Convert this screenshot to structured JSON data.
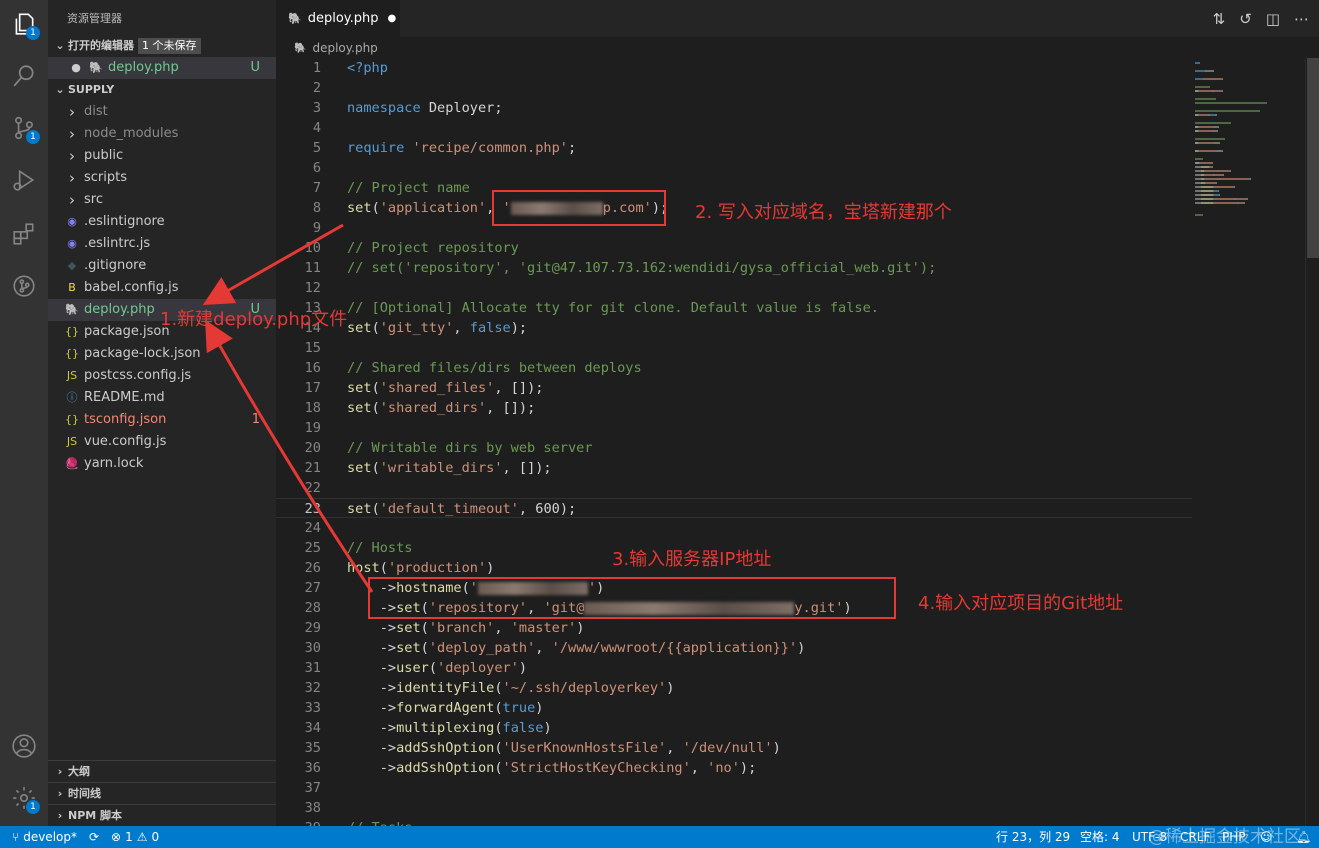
{
  "activity": {
    "explorer_badge": "1",
    "scm_badge": "1",
    "settings_badge": "1"
  },
  "sidebar": {
    "title": "资源管理器",
    "open_editors": {
      "label": "打开的编辑器",
      "unsaved": "1 个未保存",
      "file": "deploy.php",
      "status": "U"
    },
    "project": "SUPPLY",
    "items": [
      {
        "label": "dist",
        "type": "folder",
        "color": "#8c8c8c"
      },
      {
        "label": "node_modules",
        "type": "folder",
        "color": "#8c8c8c"
      },
      {
        "label": "public",
        "type": "folder",
        "color": "#cccccc"
      },
      {
        "label": "scripts",
        "type": "folder",
        "color": "#cccccc"
      },
      {
        "label": "src",
        "type": "folder",
        "color": "#cccccc"
      },
      {
        "label": ".eslintignore",
        "type": "eslint",
        "color": "#cccccc"
      },
      {
        "label": ".eslintrc.js",
        "type": "eslint",
        "color": "#cccccc"
      },
      {
        "label": ".gitignore",
        "type": "git",
        "color": "#cccccc"
      },
      {
        "label": "babel.config.js",
        "type": "babel",
        "color": "#cccccc"
      },
      {
        "label": "deploy.php",
        "type": "php",
        "color": "#73c991",
        "status": "U"
      },
      {
        "label": "package.json",
        "type": "json",
        "color": "#cccccc"
      },
      {
        "label": "package-lock.json",
        "type": "json",
        "color": "#cccccc"
      },
      {
        "label": "postcss.config.js",
        "type": "js",
        "color": "#cccccc"
      },
      {
        "label": "README.md",
        "type": "info",
        "color": "#cccccc"
      },
      {
        "label": "tsconfig.json",
        "type": "json",
        "color": "#f48771",
        "status": "1"
      },
      {
        "label": "vue.config.js",
        "type": "js",
        "color": "#cccccc"
      },
      {
        "label": "yarn.lock",
        "type": "yarn",
        "color": "#cccccc"
      }
    ],
    "outline": "大纲",
    "timeline": "时间线",
    "npm": "NPM 脚本"
  },
  "tab": {
    "label": "deploy.php"
  },
  "breadcrumb": "deploy.php",
  "code": [
    [
      [
        "<?php",
        "k"
      ]
    ],
    [],
    [
      [
        "namespace ",
        "k"
      ],
      [
        "Deployer",
        "p"
      ],
      [
        ";",
        "p"
      ]
    ],
    [],
    [
      [
        "require ",
        "k"
      ],
      [
        "'recipe/common.php'",
        "s"
      ],
      [
        ";",
        "p"
      ]
    ],
    [],
    [
      [
        "// Project name",
        "c"
      ]
    ],
    [
      [
        "set",
        "fn"
      ],
      [
        "(",
        "p"
      ],
      [
        "'application'",
        "s"
      ],
      [
        ", ",
        "p"
      ],
      [
        "'",
        "s"
      ],
      [
        "@blur:92",
        "b"
      ],
      [
        "p.com'",
        "s"
      ],
      [
        ");",
        "p"
      ]
    ],
    [],
    [
      [
        "// Project repository",
        "c"
      ]
    ],
    [
      [
        "// set('repository', 'git@47.107.73.162:wendidi/gysa_official_web.git');",
        "c"
      ]
    ],
    [],
    [
      [
        "// [Optional] Allocate tty for git clone. Default value is false.",
        "c"
      ]
    ],
    [
      [
        "set",
        "fn"
      ],
      [
        "(",
        "p"
      ],
      [
        "'git_tty'",
        "s"
      ],
      [
        ", ",
        "p"
      ],
      [
        "false",
        "k"
      ],
      [
        ");",
        "p"
      ]
    ],
    [],
    [
      [
        "// Shared files/dirs between deploys",
        "c"
      ]
    ],
    [
      [
        "set",
        "fn"
      ],
      [
        "(",
        "p"
      ],
      [
        "'shared_files'",
        "s"
      ],
      [
        ", []);",
        "p"
      ]
    ],
    [
      [
        "set",
        "fn"
      ],
      [
        "(",
        "p"
      ],
      [
        "'shared_dirs'",
        "s"
      ],
      [
        ", []);",
        "p"
      ]
    ],
    [],
    [
      [
        "// Writable dirs by web server",
        "c"
      ]
    ],
    [
      [
        "set",
        "fn"
      ],
      [
        "(",
        "p"
      ],
      [
        "'writable_dirs'",
        "s"
      ],
      [
        ", []);",
        "p"
      ]
    ],
    [],
    [
      [
        "set",
        "fn"
      ],
      [
        "(",
        "p"
      ],
      [
        "'default_timeout'",
        "s"
      ],
      [
        ", ",
        "p"
      ],
      [
        "600",
        "p"
      ],
      [
        ");",
        "p"
      ]
    ],
    [],
    [
      [
        "// Hosts",
        "c"
      ]
    ],
    [
      [
        "host",
        "fn"
      ],
      [
        "(",
        "p"
      ],
      [
        "'production'",
        "s"
      ],
      [
        ")",
        "p"
      ]
    ],
    [
      [
        "    ->",
        "p"
      ],
      [
        "hostname",
        "fn"
      ],
      [
        "(",
        "p"
      ],
      [
        "'",
        "s"
      ],
      [
        "@blur:110",
        "b"
      ],
      [
        "'",
        "s"
      ],
      [
        ")",
        "p"
      ]
    ],
    [
      [
        "    ->",
        "p"
      ],
      [
        "set",
        "fn"
      ],
      [
        "(",
        "p"
      ],
      [
        "'repository'",
        "s"
      ],
      [
        ", ",
        "p"
      ],
      [
        "'git@",
        "s"
      ],
      [
        "@blur:210",
        "b"
      ],
      [
        "y.git'",
        "s"
      ],
      [
        ")",
        "p"
      ]
    ],
    [
      [
        "    ->",
        "p"
      ],
      [
        "set",
        "fn"
      ],
      [
        "(",
        "p"
      ],
      [
        "'branch'",
        "s"
      ],
      [
        ", ",
        "p"
      ],
      [
        "'master'",
        "s"
      ],
      [
        ")",
        "p"
      ]
    ],
    [
      [
        "    ->",
        "p"
      ],
      [
        "set",
        "fn"
      ],
      [
        "(",
        "p"
      ],
      [
        "'deploy_path'",
        "s"
      ],
      [
        ", ",
        "p"
      ],
      [
        "'/www/wwwroot/{{application}}'",
        "s"
      ],
      [
        ")",
        "p"
      ]
    ],
    [
      [
        "    ->",
        "p"
      ],
      [
        "user",
        "fn"
      ],
      [
        "(",
        "p"
      ],
      [
        "'deployer'",
        "s"
      ],
      [
        ")",
        "p"
      ]
    ],
    [
      [
        "    ->",
        "p"
      ],
      [
        "identityFile",
        "fn"
      ],
      [
        "(",
        "p"
      ],
      [
        "'~/.ssh/deployerkey'",
        "s"
      ],
      [
        ")",
        "p"
      ]
    ],
    [
      [
        "    ->",
        "p"
      ],
      [
        "forwardAgent",
        "fn"
      ],
      [
        "(",
        "p"
      ],
      [
        "true",
        "k"
      ],
      [
        ")",
        "p"
      ]
    ],
    [
      [
        "    ->",
        "p"
      ],
      [
        "multiplexing",
        "fn"
      ],
      [
        "(",
        "p"
      ],
      [
        "false",
        "k"
      ],
      [
        ")",
        "p"
      ]
    ],
    [
      [
        "    ->",
        "p"
      ],
      [
        "addSshOption",
        "fn"
      ],
      [
        "(",
        "p"
      ],
      [
        "'UserKnownHostsFile'",
        "s"
      ],
      [
        ", ",
        "p"
      ],
      [
        "'/dev/null'",
        "s"
      ],
      [
        ")",
        "p"
      ]
    ],
    [
      [
        "    ->",
        "p"
      ],
      [
        "addSshOption",
        "fn"
      ],
      [
        "(",
        "p"
      ],
      [
        "'StrictHostKeyChecking'",
        "s"
      ],
      [
        ", ",
        "p"
      ],
      [
        "'no'",
        "s"
      ],
      [
        ");",
        "p"
      ]
    ],
    [],
    [],
    [
      [
        "// Tasks",
        "c"
      ]
    ]
  ],
  "current_line": 23,
  "status": {
    "branch": "develop*",
    "errors": "1",
    "warnings": "0",
    "position": "行 23，列 29",
    "spaces": "空格: 4",
    "encoding": "UTF-8",
    "eol": "CRLF",
    "language": "PHP"
  },
  "watermark": "@稀土掘金技术社区",
  "annotations": {
    "a1": "1.新建deploy.php文件",
    "a2": "2. 写入对应域名，宝塔新建那个",
    "a3": "3.输入服务器IP地址",
    "a4": "4.输入对应项目的Git地址"
  },
  "colors": {
    "accent": "#007acc",
    "annotation": "#e53935"
  }
}
